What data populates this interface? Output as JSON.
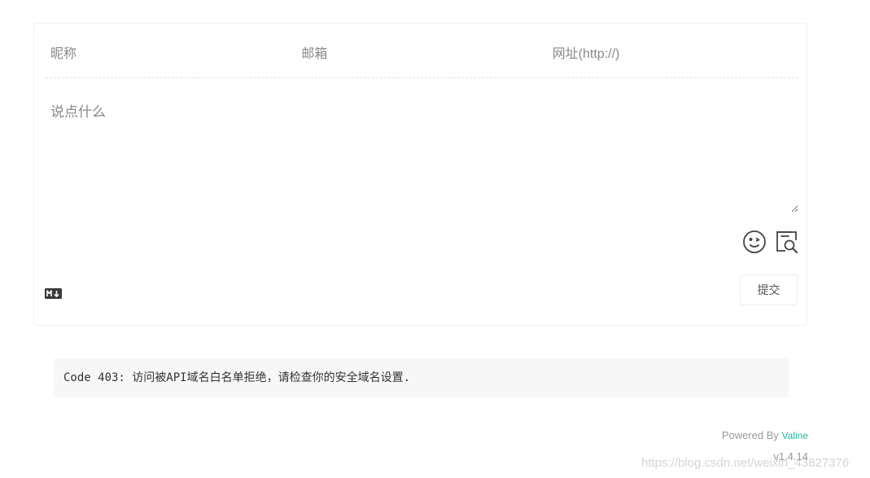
{
  "form": {
    "nickname_placeholder": "昵称",
    "email_placeholder": "邮箱",
    "website_placeholder": "网址(http://)",
    "comment_placeholder": "说点什么",
    "submit_label": "提交"
  },
  "icons": {
    "emoji": "emoji-icon",
    "preview": "preview-icon",
    "markdown": "markdown-icon"
  },
  "error": {
    "message": "Code 403: 访问被API域名白名单拒绝，请检查你的安全域名设置."
  },
  "footer": {
    "powered_by": "Powered By",
    "brand": "Valine",
    "version": "v1.4.14"
  },
  "watermark": "https://blog.csdn.net/weixin_43827376",
  "colors": {
    "brand_link": "#1abc9c",
    "error_bg": "#f7f7f7",
    "border": "#f0f0f0"
  }
}
